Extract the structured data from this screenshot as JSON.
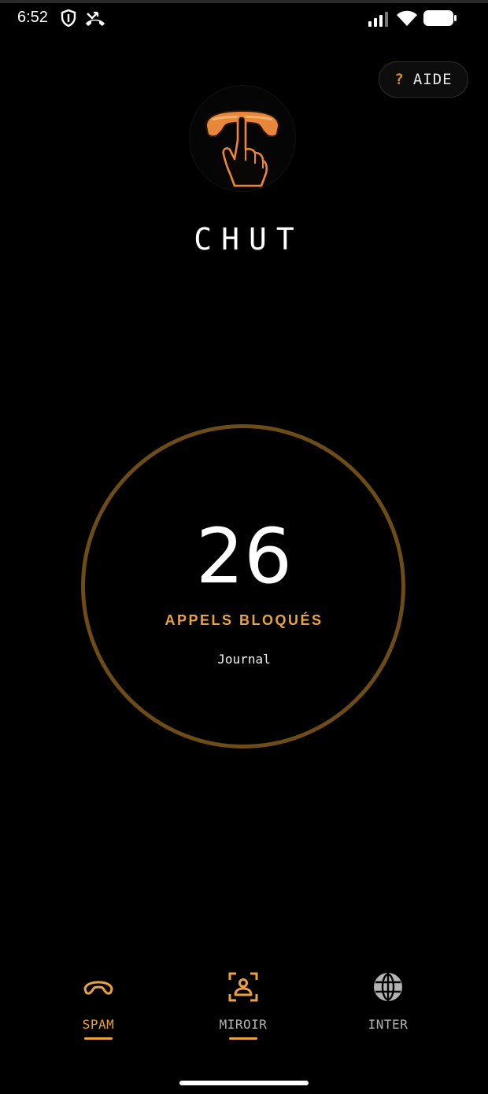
{
  "status_bar": {
    "time": "6:52",
    "icons": [
      "shield-icon",
      "missed-call-icon",
      "signal-icon",
      "wifi-icon",
      "battery-icon"
    ]
  },
  "header": {
    "help_glyph": "?",
    "help_label": "AIDE",
    "logo_icon": "hand-hangup-phone-icon",
    "title": "CHUT"
  },
  "counter": {
    "value": "26",
    "label": "APPELS BLOQUÉS",
    "journal_label": "Journal"
  },
  "nav": {
    "items": [
      {
        "label": "SPAM",
        "icon": "hangup-phone-icon",
        "active": true
      },
      {
        "label": "MIROIR",
        "icon": "contact-scan-icon",
        "active": false
      },
      {
        "label": "INTER",
        "icon": "globe-icon",
        "active": false
      }
    ]
  },
  "colors": {
    "accent": "#e9a23f",
    "ring": "#6e4c17",
    "logo_orange": "#e8873a",
    "nav_inactive": "#b3b3b3",
    "background": "#000000"
  }
}
